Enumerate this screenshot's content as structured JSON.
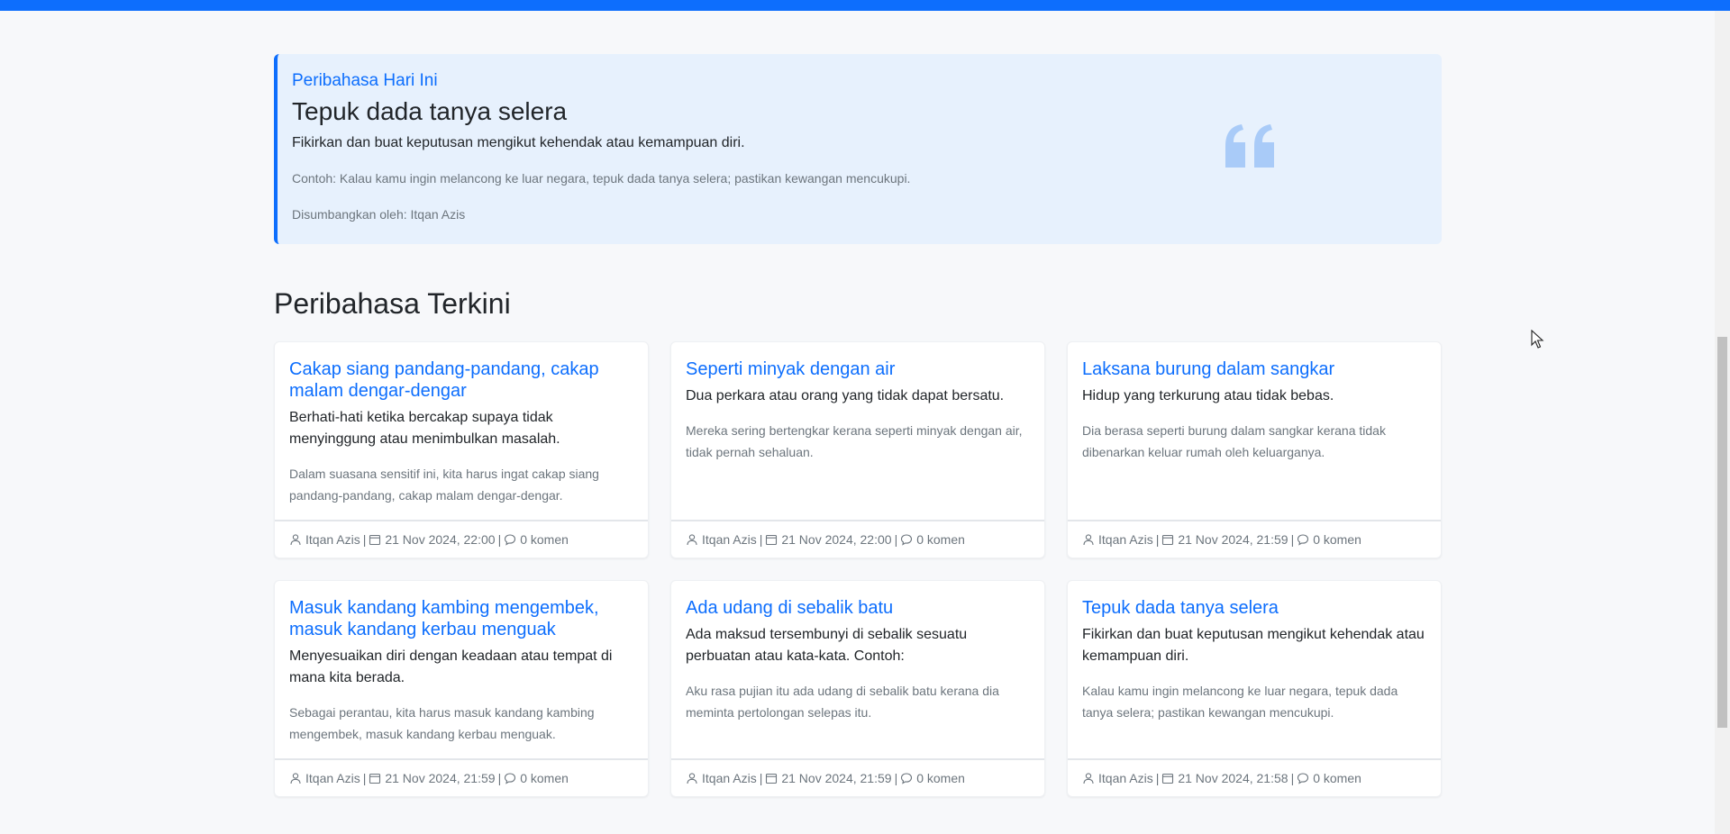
{
  "featured": {
    "kicker": "Peribahasa Hari Ini",
    "title": "Tepuk dada tanya selera",
    "meaning": "Fikirkan dan buat keputusan mengikut kehendak atau kemampuan diri.",
    "example": "Contoh: Kalau kamu ingin melancong ke luar negara, tepuk dada tanya selera; pastikan kewangan mencukupi.",
    "author": "Disumbangkan oleh: Itqan Azis",
    "quote_icon": "quote-icon"
  },
  "latest": {
    "heading": "Peribahasa Terkini",
    "cards": [
      {
        "title": "Cakap siang pandang-pandang, cakap malam dengar-dengar",
        "meaning": "Berhati-hati ketika bercakap supaya tidak menyinggung atau menimbulkan masalah.",
        "example": "Dalam suasana sensitif ini, kita harus ingat cakap siang pandang-pandang, cakap malam dengar-dengar.",
        "author": "Itqan Azis",
        "date": "21 Nov 2024, 22:00",
        "comments": "0 komen"
      },
      {
        "title": "Seperti minyak dengan air",
        "meaning": "Dua perkara atau orang yang tidak dapat bersatu.",
        "example": "Mereka sering bertengkar kerana seperti minyak dengan air, tidak pernah sehaluan.",
        "author": "Itqan Azis",
        "date": "21 Nov 2024, 22:00",
        "comments": "0 komen"
      },
      {
        "title": "Laksana burung dalam sangkar",
        "meaning": "Hidup yang terkurung atau tidak bebas.",
        "example": "Dia berasa seperti burung dalam sangkar kerana tidak dibenarkan keluar rumah oleh keluarganya.",
        "author": "Itqan Azis",
        "date": "21 Nov 2024, 21:59",
        "comments": "0 komen"
      },
      {
        "title": "Masuk kandang kambing mengembek, masuk kandang kerbau menguak",
        "meaning": "Menyesuaikan diri dengan keadaan atau tempat di mana kita berada.",
        "example": "Sebagai perantau, kita harus masuk kandang kambing mengembek, masuk kandang kerbau menguak.",
        "author": "Itqan Azis",
        "date": "21 Nov 2024, 21:59",
        "comments": "0 komen"
      },
      {
        "title": "Ada udang di sebalik batu",
        "meaning": "Ada maksud tersembunyi di sebalik sesuatu perbuatan atau kata-kata. Contoh:",
        "example": "Aku rasa pujian itu ada udang di sebalik batu kerana dia meminta pertolongan selepas itu.",
        "author": "Itqan Azis",
        "date": "21 Nov 2024, 21:59",
        "comments": "0 komen"
      },
      {
        "title": "Tepuk dada tanya selera",
        "meaning": "Fikirkan dan buat keputusan mengikut kehendak atau kemampuan diri.",
        "example": "Kalau kamu ingin melancong ke luar negara, tepuk dada tanya selera; pastikan kewangan mencukupi.",
        "author": "Itqan Azis",
        "date": "21 Nov 2024, 21:58",
        "comments": "0 komen"
      }
    ]
  },
  "colors": {
    "accent": "#0d6efd",
    "featured_bg": "#e7f1fd",
    "muted": "#6c757d"
  }
}
